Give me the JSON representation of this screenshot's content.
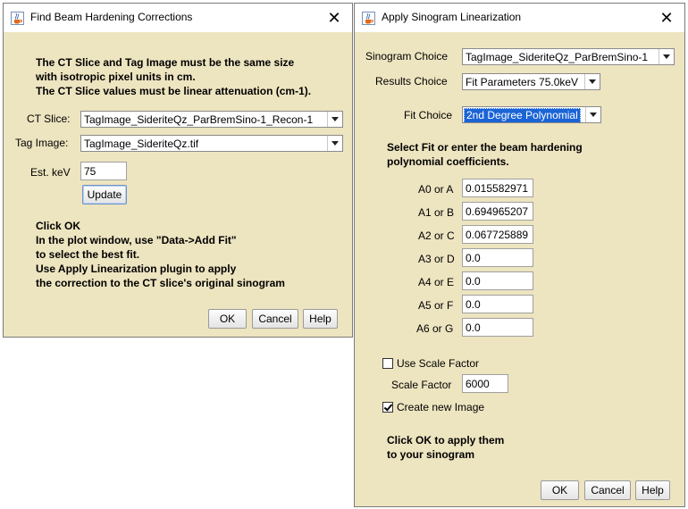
{
  "left_window": {
    "title": "Find Beam Hardening Corrections",
    "info_lines": [
      "The CT Slice and Tag Image must be the same size",
      "with isotropic pixel units in cm.",
      "The CT Slice values must be linear attenuation (cm-1)."
    ],
    "ct_slice_label": "CT Slice:",
    "ct_slice_value": "TagImage_SideriteQz_ParBremSino-1_Recon-1",
    "tag_image_label": "Tag Image:",
    "tag_image_value": "TagImage_SideriteQz.tif",
    "est_kev_label": "Est. keV",
    "est_kev_value": "75",
    "update_label": "Update",
    "instruction_lines": [
      "Click OK",
      "In the plot window, use \"Data->Add Fit\"",
      "to select the best fit.",
      "Use Apply Linearization plugin to apply",
      "the correction to the CT slice's original sinogram"
    ],
    "ok_label": "OK",
    "cancel_label": "Cancel",
    "help_label": "Help"
  },
  "right_window": {
    "title": "Apply Sinogram Linearization",
    "sinogram_choice_label": "Sinogram Choice",
    "sinogram_choice_value": "TagImage_SideriteQz_ParBremSino-1",
    "results_choice_label": "Results Choice",
    "results_choice_value": "Fit Parameters 75.0keV",
    "fit_choice_label": "Fit Choice",
    "fit_choice_value": "2nd Degree Polynomial",
    "select_fit_lines": [
      "Select Fit or enter the beam hardening",
      "polynomial coefficients."
    ],
    "coefficients": [
      {
        "label": "A0 or A",
        "value": "0.015582971"
      },
      {
        "label": "A1 or B",
        "value": "0.694965207"
      },
      {
        "label": "A2 or C",
        "value": "0.067725889"
      },
      {
        "label": "A3 or D",
        "value": "0.0"
      },
      {
        "label": "A4 or E",
        "value": "0.0"
      },
      {
        "label": "A5 or F",
        "value": "0.0"
      },
      {
        "label": "A6 or G",
        "value": "0.0"
      }
    ],
    "use_scale_factor_label": "Use Scale Factor",
    "use_scale_factor_checked": false,
    "scale_factor_label": "Scale Factor",
    "scale_factor_value": "6000",
    "create_new_image_label": "Create new Image",
    "create_new_image_checked": true,
    "apply_lines": [
      "Click OK to apply them",
      "to your sinogram"
    ],
    "ok_label": "OK",
    "cancel_label": "Cancel",
    "help_label": "Help"
  },
  "colors": {
    "dialog_bg": "#ede4c0",
    "selection_blue": "#1b64d6",
    "titlebar_bg": "#ffffff"
  },
  "icons": {
    "java_app_icon": "java-coffee-cup-icon",
    "close_icon": "close-x-icon",
    "dropdown_icon": "chevron-down-icon"
  }
}
